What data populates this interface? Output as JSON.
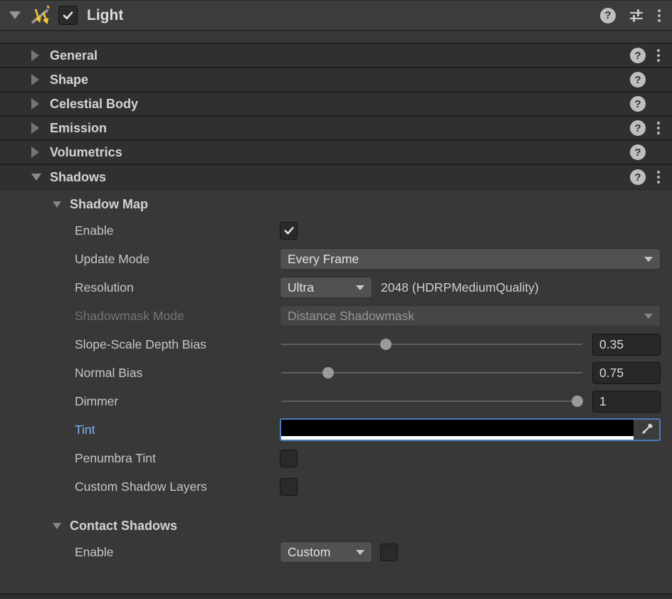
{
  "component": {
    "title": "Light",
    "enabled_checked": true,
    "icon": "directional-light-icon",
    "header_buttons": [
      "help",
      "presets",
      "more-options"
    ]
  },
  "collapsed_sections": [
    {
      "label": "General",
      "has_help": true,
      "has_menu": true
    },
    {
      "label": "Shape",
      "has_help": true,
      "has_menu": false
    },
    {
      "label": "Celestial Body",
      "has_help": true,
      "has_menu": false
    },
    {
      "label": "Emission",
      "has_help": true,
      "has_menu": true
    },
    {
      "label": "Volumetrics",
      "has_help": true,
      "has_menu": false
    }
  ],
  "shadows_section": {
    "label": "Shadows",
    "expanded": true,
    "has_help": true,
    "has_menu": true,
    "shadow_map": {
      "label": "Shadow Map",
      "enable": {
        "label": "Enable",
        "checked": true
      },
      "update_mode": {
        "label": "Update Mode",
        "value": "Every Frame"
      },
      "resolution": {
        "label": "Resolution",
        "value": "Ultra",
        "detail": "2048 (HDRPMediumQuality)"
      },
      "shadowmask_mode": {
        "label": "Shadowmask Mode",
        "value": "Distance Shadowmask",
        "disabled": true
      },
      "slope_scale_depth_bias": {
        "label": "Slope-Scale Depth Bias",
        "value": "0.35",
        "percent": 35
      },
      "normal_bias": {
        "label": "Normal Bias",
        "value": "0.75",
        "percent": 16
      },
      "dimmer": {
        "label": "Dimmer",
        "value": "1",
        "percent": 98
      },
      "tint": {
        "label": "Tint",
        "color": "#000000",
        "alpha_percent": 100,
        "is_override": true
      },
      "penumbra_tint": {
        "label": "Penumbra Tint",
        "checked": false
      },
      "custom_shadow_layers": {
        "label": "Custom Shadow Layers",
        "checked": false
      }
    },
    "contact_shadows": {
      "label": "Contact Shadows",
      "enable": {
        "label": "Enable",
        "value": "Custom",
        "checked": false
      }
    }
  },
  "help_glyph": "?"
}
